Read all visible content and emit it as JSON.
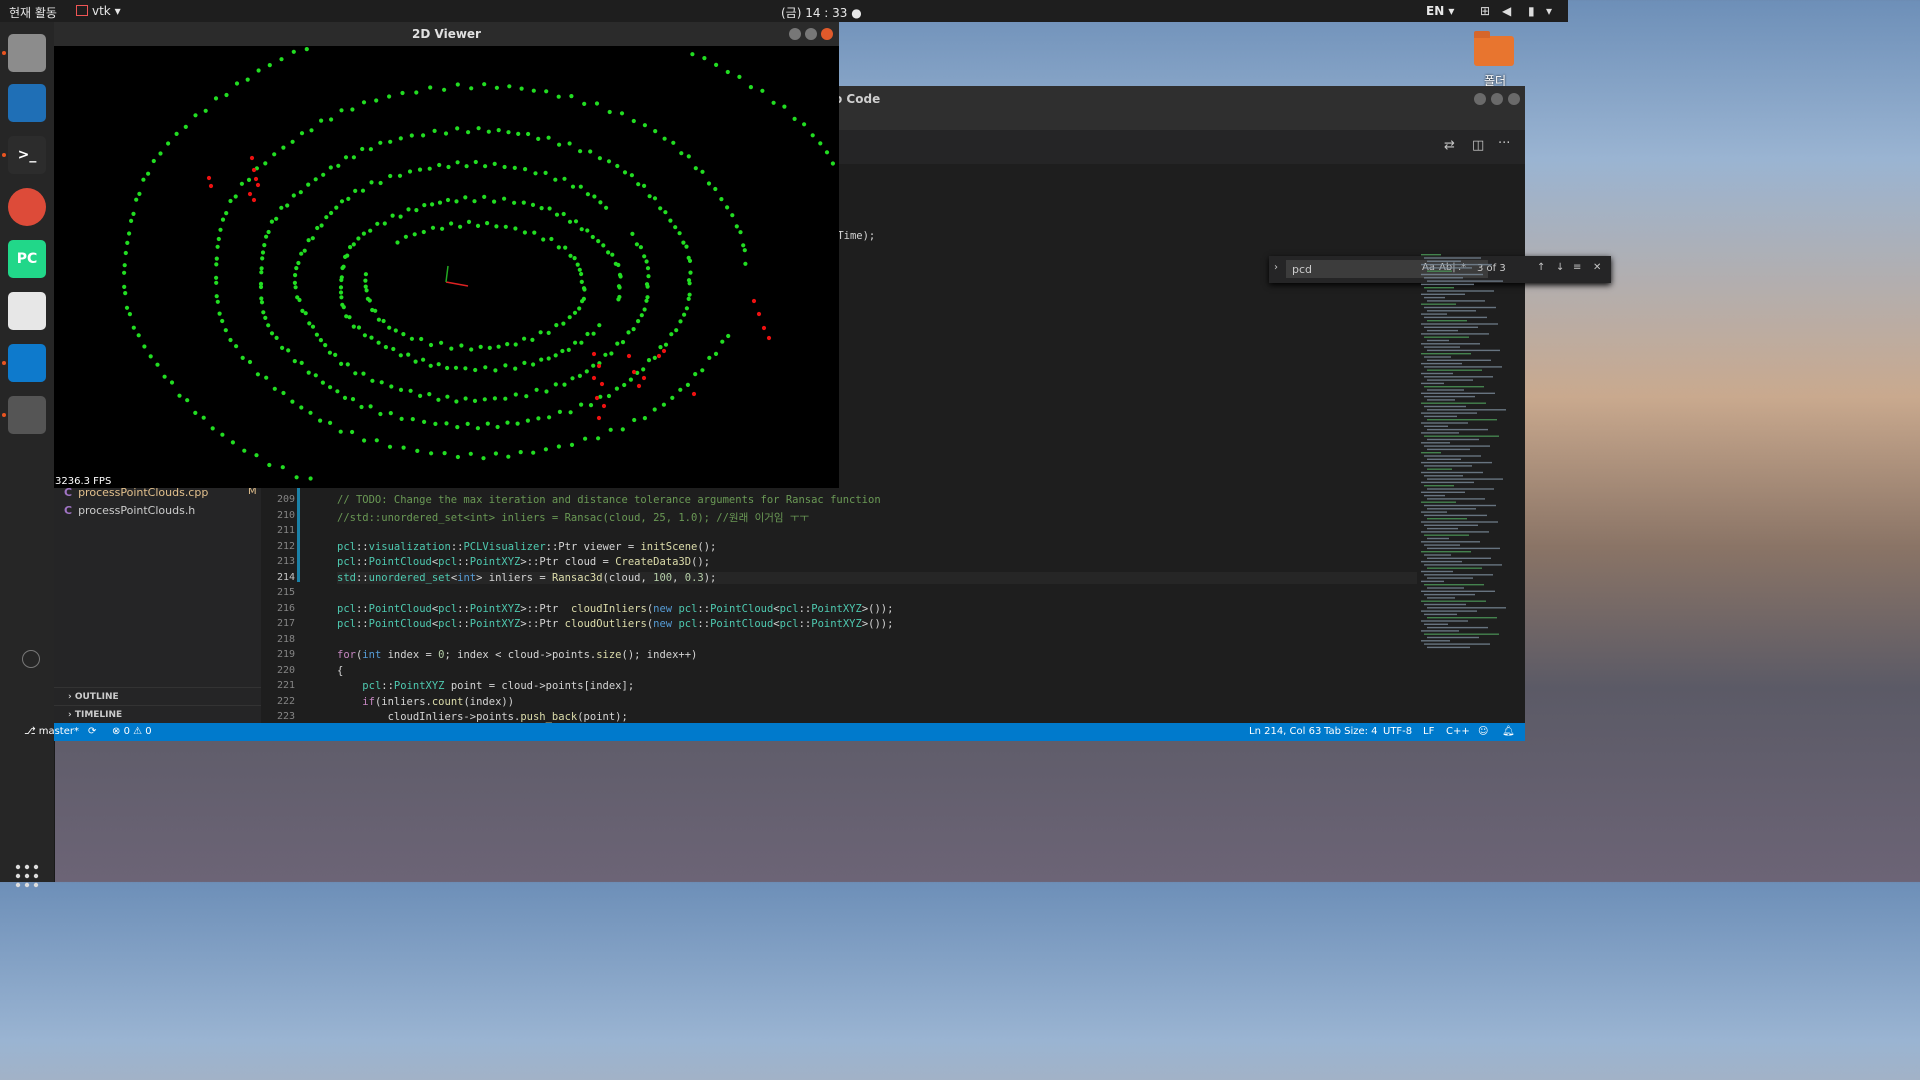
{
  "topbar": {
    "activities": "현재 활동",
    "app_menu": "vtk",
    "clock": "(금) 14 : 33",
    "lang": "EN"
  },
  "desktop": {
    "folder_label": "폴더"
  },
  "dock": {
    "items": [
      {
        "name": "files",
        "color": "#8c8c8c",
        "label": ""
      },
      {
        "name": "writer",
        "color": "#1f6fb6",
        "label": ""
      },
      {
        "name": "terminal",
        "color": "#2c2c2c",
        "label": ">_"
      },
      {
        "name": "chrome",
        "color": "#dd4b39",
        "label": ""
      },
      {
        "name": "pycharm",
        "color": "#21d789",
        "label": "PC"
      },
      {
        "name": "text-editor",
        "color": "#e7e7e7",
        "label": ""
      },
      {
        "name": "vscode",
        "color": "#0e7acc",
        "label": ""
      },
      {
        "name": "error-app",
        "color": "#555555",
        "label": ""
      }
    ]
  },
  "viewer": {
    "title": "2D Viewer",
    "fps": "3236.3 FPS",
    "colors": {
      "inlier": "#22dd22",
      "outlier": "#ee1111",
      "axis_x": "#dd2222",
      "axis_y": "#22aa22"
    }
  },
  "vscode": {
    "title_suffix": "o Code",
    "find": {
      "query": "pcd",
      "count": "3 of 3",
      "aa": "Aa",
      "ab": "Ab|",
      "regex": ".*"
    },
    "files": [
      {
        "prefix": "C",
        "name": "processPointClouds.cpp",
        "badge": "M"
      },
      {
        "prefix": "C",
        "name": "processPointClouds.h",
        "badge": ""
      }
    ],
    "sections": [
      "OUTLINE",
      "TIMELINE"
    ],
    "partial_code_top": "tTime);",
    "lines": [
      {
        "n": "209",
        "text": "// TODO: Change the max iteration and distance tolerance arguments for Ransac function"
      },
      {
        "n": "210",
        "text": "//std::unordered_set<int> inliers = Ransac(cloud, 25, 1.0); //원래 이거임 ㅜㅜ"
      },
      {
        "n": "211",
        "text": ""
      },
      {
        "n": "212",
        "text": "pcl::visualization::PCLVisualizer::Ptr viewer = initScene();"
      },
      {
        "n": "213",
        "text": "pcl::PointCloud<pcl::PointXYZ>::Ptr cloud = CreateData3D();"
      },
      {
        "n": "214",
        "text": "std::unordered_set<int> inliers = Ransac3d(cloud, 100, 0.3);"
      },
      {
        "n": "215",
        "text": ""
      },
      {
        "n": "216",
        "text": "pcl::PointCloud<pcl::PointXYZ>::Ptr  cloudInliers(new pcl::PointCloud<pcl::PointXYZ>());"
      },
      {
        "n": "217",
        "text": "pcl::PointCloud<pcl::PointXYZ>::Ptr cloudOutliers(new pcl::PointCloud<pcl::PointXYZ>());"
      },
      {
        "n": "218",
        "text": ""
      },
      {
        "n": "219",
        "text": "for(int index = 0; index < cloud->points.size(); index++)"
      },
      {
        "n": "220",
        "text": "{"
      },
      {
        "n": "221",
        "text": "    pcl::PointXYZ point = cloud->points[index];"
      },
      {
        "n": "222",
        "text": "    if(inliers.count(index))"
      },
      {
        "n": "223",
        "text": "        cloudInliers->points.push_back(point);"
      }
    ],
    "status": {
      "branch": "master*",
      "errors": "0",
      "warnings": "0",
      "position": "Ln 214, Col 63",
      "tab_size": "Tab Size: 4",
      "encoding": "UTF-8",
      "eol": "LF",
      "language": "C++"
    }
  }
}
